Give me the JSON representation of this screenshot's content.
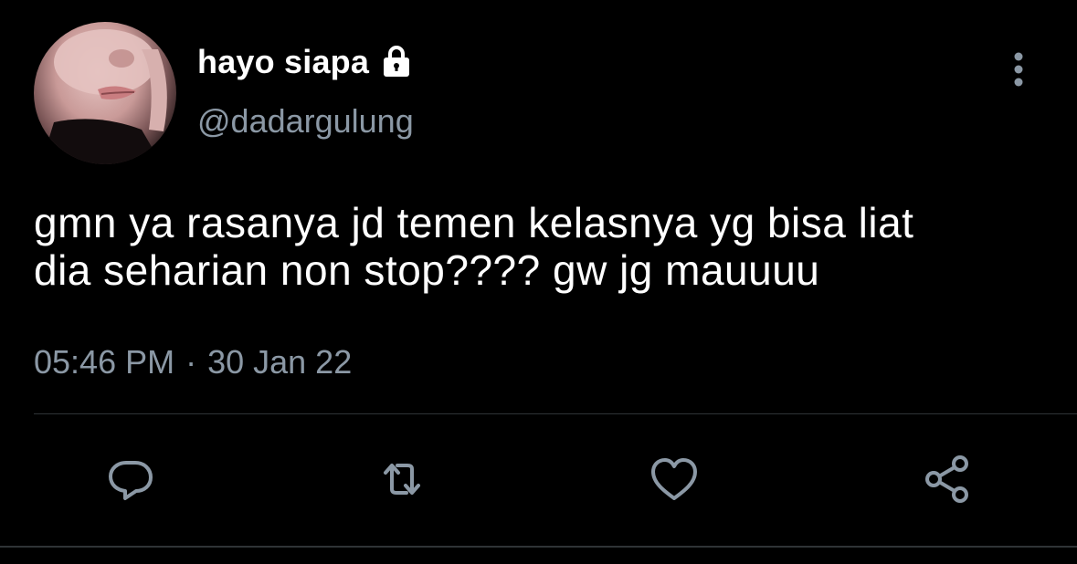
{
  "tweet": {
    "display_name": "hayo siapa",
    "handle": "@dadargulung",
    "text": "gmn ya rasanya jd temen kelasnya yg bisa liat\ndia seharian non stop???? gw jg mauuuu",
    "time": "05:46 PM",
    "separator": "·",
    "date": "30 Jan 22"
  },
  "icons": {
    "lock": "lock-icon",
    "more": "more-vertical-icon",
    "reply": "reply-icon",
    "retweet": "retweet-icon",
    "like": "heart-icon",
    "share": "share-icon"
  },
  "colors": {
    "background": "#000000",
    "primary_text": "#ffffff",
    "secondary_text": "#8b98a5",
    "divider": "#2f3336"
  }
}
